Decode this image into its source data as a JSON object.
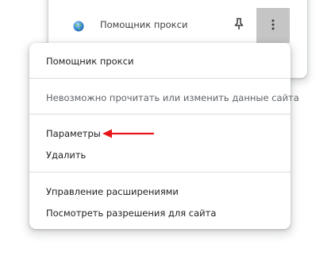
{
  "extensions_panel": {
    "extension_name": "Помощник прокси",
    "icon": "globe-icon",
    "pin_icon": "pin-icon",
    "more_icon": "more-vert-icon"
  },
  "context_menu": {
    "extension_title": "Помощник прокси",
    "site_access": "Невозможно прочитать или изменить данные сайта",
    "options": "Параметры",
    "remove": "Удалить",
    "manage_extensions": "Управление расширениями",
    "view_site_permissions": "Посмотреть разрешения для сайта"
  },
  "annotation": {
    "color": "#e8161b",
    "icon": "arrow-left-icon"
  }
}
